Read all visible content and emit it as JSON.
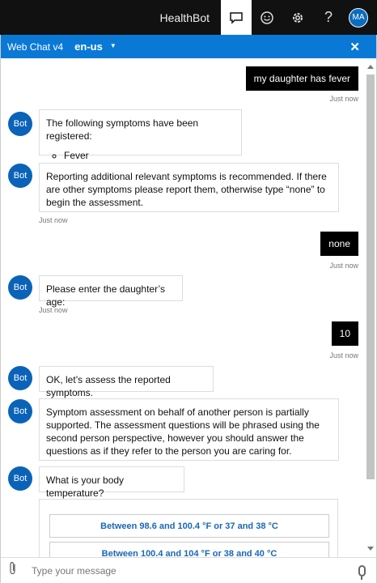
{
  "topbar": {
    "brand": "HealthBot",
    "icons": [
      "chat-icon",
      "smiley-icon",
      "settings-icon",
      "help-icon"
    ],
    "avatar_initials": "MA"
  },
  "webchat_header": {
    "title": "Web Chat v4",
    "language": "en-us",
    "close_symbol": "✕"
  },
  "messages": [
    {
      "from": "user",
      "text": "my daughter has fever",
      "timestamp": "Just now"
    },
    {
      "from": "bot",
      "avatar": "Bot",
      "text": "The following symptoms have been registered:",
      "list": [
        "Fever"
      ]
    },
    {
      "from": "bot",
      "avatar": "Bot",
      "text": "Reporting additional relevant symptoms is recommended. If there are other symptoms please report them, otherwise type “none” to begin the assessment.",
      "timestamp": "Just now"
    },
    {
      "from": "user",
      "text": "none",
      "timestamp": "Just now"
    },
    {
      "from": "bot",
      "avatar": "Bot",
      "text": "Please enter the daughter’s age:",
      "timestamp": "Just now"
    },
    {
      "from": "user",
      "text": "10",
      "timestamp": "Just now"
    },
    {
      "from": "bot",
      "avatar": "Bot",
      "text": "OK, let’s assess the reported symptoms."
    },
    {
      "from": "bot",
      "avatar": "Bot",
      "text": "Symptom assessment on behalf of another person is partially supported. The assessment questions will be phrased using the second person perspective, however you should answer the questions as if they refer to the person you are caring for."
    },
    {
      "from": "bot",
      "avatar": "Bot",
      "text": "What is your body temperature?"
    }
  ],
  "choices": [
    "Between 98.6 and 100.4 °F or 37 and 38 °C",
    "Between 100.4 and 104 °F or 38 and 40 °C"
  ],
  "input": {
    "placeholder": "Type your message"
  },
  "colors": {
    "topbar_bg": "#111111",
    "header_bg": "#0a79d6",
    "bot_avatar": "#0a63b8",
    "choice_text": "#1a67b6"
  }
}
